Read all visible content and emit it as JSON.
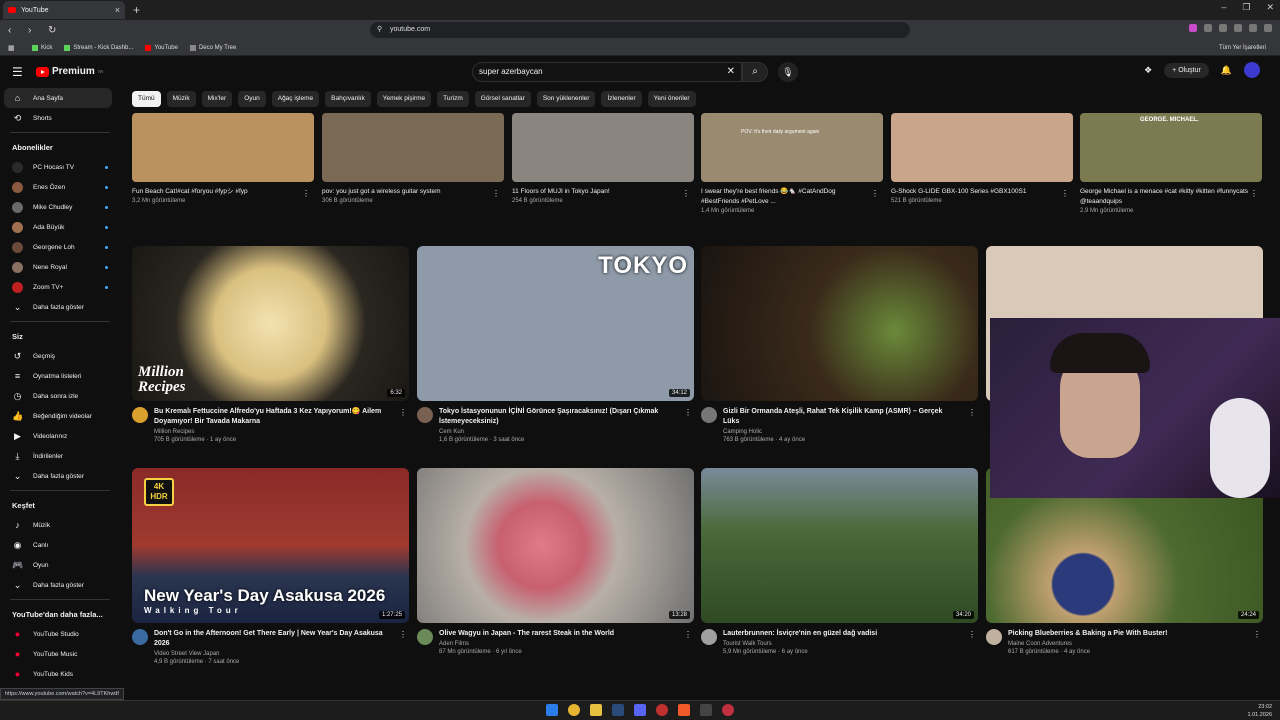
{
  "browser": {
    "tab_title": "YouTube",
    "url": "youtube.com",
    "bookmarks": [
      "Kick",
      "Stream - Kick Dashb...",
      "YouTube",
      "Deco My Tree"
    ],
    "bookmarks_right": "Tüm Yer İşaretleri"
  },
  "header": {
    "logo": "Premium",
    "logo_sup": "TR",
    "search_value": "super azerbaycan",
    "create_label": "Oluştur"
  },
  "sidebar": {
    "main": [
      {
        "label": "Ana Sayfa",
        "icon": "home-icon"
      },
      {
        "label": "Shorts",
        "icon": "shorts-icon"
      }
    ],
    "subs_title": "Abonelikler",
    "subs": [
      "PC Hocası TV",
      "Enes Özen",
      "Mike Chudley",
      "Ada Büyük",
      "Georgene Loh",
      "Nene Royal",
      "Zoom TV+"
    ],
    "subs_more": "Daha fazla göster",
    "you_title": "Siz",
    "you": [
      "Geçmiş",
      "Oynatma listeleri",
      "Daha sonra izle",
      "Beğendiğim videolar",
      "Videolarınız",
      "İndirilenler"
    ],
    "you_more": "Daha fazla göster",
    "explore_title": "Keşfet",
    "explore": [
      "Müzik",
      "Canlı",
      "Oyun"
    ],
    "explore_more": "Daha fazla göster",
    "more_title": "YouTube'dan daha fazla...",
    "more": [
      "YouTube Studio",
      "YouTube Music",
      "YouTube Kids"
    ]
  },
  "chips": [
    "Tümü",
    "Müzik",
    "Mix'ler",
    "Oyun",
    "Ağaç işleme",
    "Bahçıvanlık",
    "Yemek pişirme",
    "Turizm",
    "Görsel sanatlar",
    "Son yüklenenler",
    "İzlenenler",
    "Yeni öneriler"
  ],
  "shorts": [
    {
      "title": "Fun Beach Cat!#cat #foryou #fypシ #fyp",
      "meta": "3,2 Mn görüntüleme",
      "color": "#b9925f"
    },
    {
      "title": "pov: you just got a wireless guitar system",
      "meta": "306 B görüntüleme",
      "color": "#7a6a55"
    },
    {
      "title": "11 Floors of MUJI in Tokyo Japan!",
      "meta": "254 B görüntüleme",
      "color": "#8b8580"
    },
    {
      "title": "I swear they're best friends 😂🐁 #CatAndDog #BestFriends #PetLove ...",
      "meta": "1,4 Mn görüntüleme",
      "color": "#9a8a70",
      "overlay": "POV: It's their daily argument again"
    },
    {
      "title": "G-Shock G-LIDE GBX-100 Series #GBX100S1",
      "meta": "521 B görüntüleme",
      "color": "#c9a58c"
    },
    {
      "title": "George Michael is a menace #cat #kitty #kitten #funnycats @teaandquips",
      "meta": "2,9 Mn görüntüleme",
      "color": "#7c7a50",
      "overlay": "GEORGE. MICHAEL."
    }
  ],
  "videos": [
    {
      "title": "Bu Kremalı Fettuccine Alfredo'yu Haftada 3 Kez Yapıyorum!😋 Ailem Doyamıyor! Bir Tavada Makarna",
      "channel": "Million Recipes",
      "meta": "705 B görüntüleme · 1 ay önce",
      "duration": "6:32",
      "color": "#3a3226",
      "overlay": "Million Recipes"
    },
    {
      "title": "Tokyo İstasyonunun İÇİNİ Görünce Şaşıracaksınız! (Dışarı Çıkmak İstemeyeceksiniz)",
      "channel": "Cem Kun",
      "meta": "1,6 B görüntüleme · 3 saat önce",
      "duration": "34:12",
      "color": "#8e9aa8",
      "overlay": "TOKYO"
    },
    {
      "title": "Gizli Bir Ormanda Ateşli, Rahat Tek Kişilik Kamp (ASMR) – Gerçek Lüks",
      "channel": "Camping Holic",
      "meta": "763 B görüntüleme · 4 ay önce",
      "duration": "",
      "color": "#3b2a20"
    },
    {
      "title": "",
      "channel": "",
      "meta": "",
      "duration": "",
      "color": "#d9c9b8"
    },
    {
      "title": "Don't Go in the Afternoon! Get There Early | New Year's Day Asakusa 2026",
      "channel": "Video Street View Japan",
      "meta": "4,9 B görüntüleme · 7 saat önce",
      "duration": "1:27:25",
      "color": "#8a2a28",
      "overlay": "New Year's Day Asakusa 2026",
      "badge": "4K HDR",
      "sub_overlay": "Walking Tour"
    },
    {
      "title": "Olive Wagyu in Japan - The rarest Steak in the World",
      "channel": "Aden Films",
      "meta": "87 Mn görüntüleme · 6 yıl önce",
      "duration": "13:28",
      "color": "#c7bcb4"
    },
    {
      "title": "Lauterbrunnen: İsviçre'nin en güzel dağ vadisi",
      "channel": "Tourist Walk Tours",
      "meta": "5,9 Mn görüntüleme · 6 ay önce",
      "duration": "34:20",
      "color": "#3d5a2e"
    },
    {
      "title": "Picking Blueberries & Baking a Pie With Buster!",
      "channel": "Maine Coon Adventures",
      "meta": "617 B görüntüleme · 4 ay önce",
      "duration": "24:24",
      "color": "#4d6a30"
    }
  ],
  "status_url": "https://www.youtube.com/watch?v=4L9TKhwdf",
  "clock": {
    "time": "23:02",
    "date": "1.01.2026"
  }
}
